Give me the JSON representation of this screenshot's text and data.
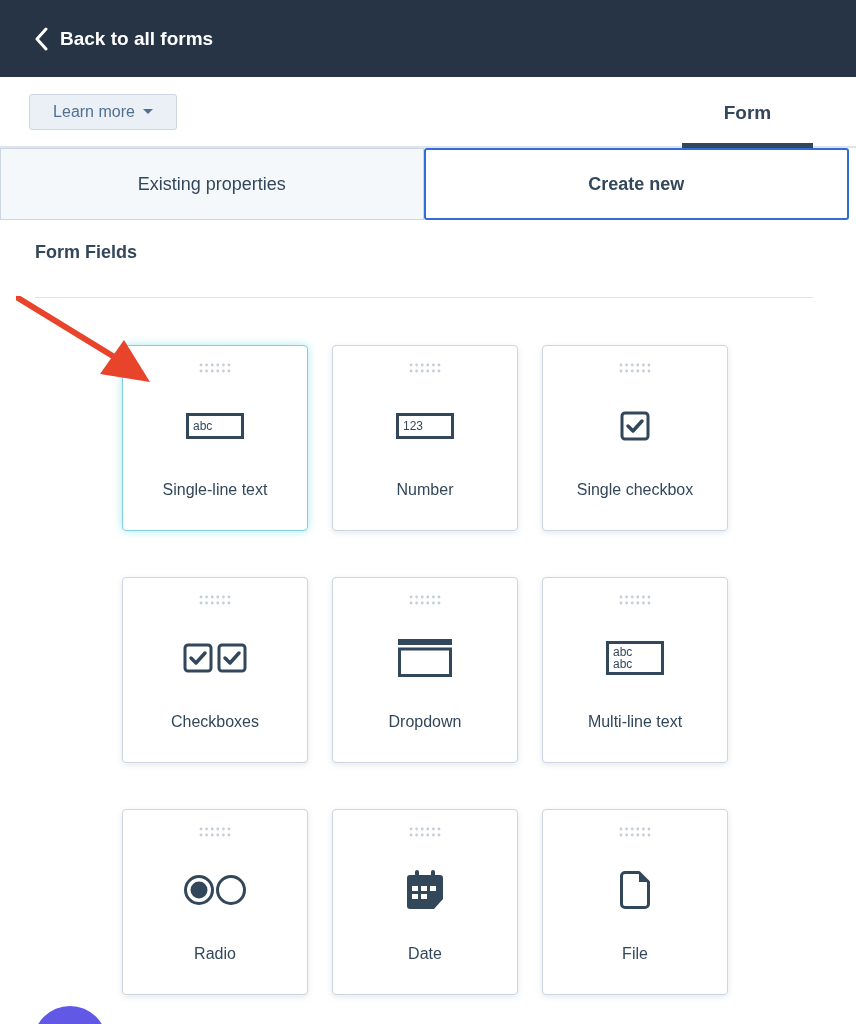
{
  "header": {
    "back_label": "Back to all forms"
  },
  "toolbar": {
    "learn_more": "Learn more",
    "tabs": [
      {
        "label": "Form",
        "selected": true
      }
    ]
  },
  "panel_tabs": [
    {
      "label": "Existing properties",
      "selected": false
    },
    {
      "label": "Create new",
      "selected": true
    }
  ],
  "section_title": "Form Fields",
  "fields": [
    {
      "label": "Single-line text",
      "kind": "text",
      "icon_text": [
        "abc"
      ],
      "selected": true
    },
    {
      "label": "Number",
      "kind": "text",
      "icon_text": [
        "123"
      ],
      "selected": false
    },
    {
      "label": "Single checkbox",
      "kind": "checkbox",
      "selected": false
    },
    {
      "label": "Checkboxes",
      "kind": "checkboxes",
      "selected": false
    },
    {
      "label": "Dropdown",
      "kind": "dropdown",
      "selected": false
    },
    {
      "label": "Multi-line text",
      "kind": "text",
      "icon_text": [
        "abc",
        "abc"
      ],
      "selected": false
    },
    {
      "label": "Radio",
      "kind": "radio",
      "selected": false
    },
    {
      "label": "Date",
      "kind": "date",
      "selected": false
    },
    {
      "label": "File",
      "kind": "file",
      "selected": false
    }
  ]
}
